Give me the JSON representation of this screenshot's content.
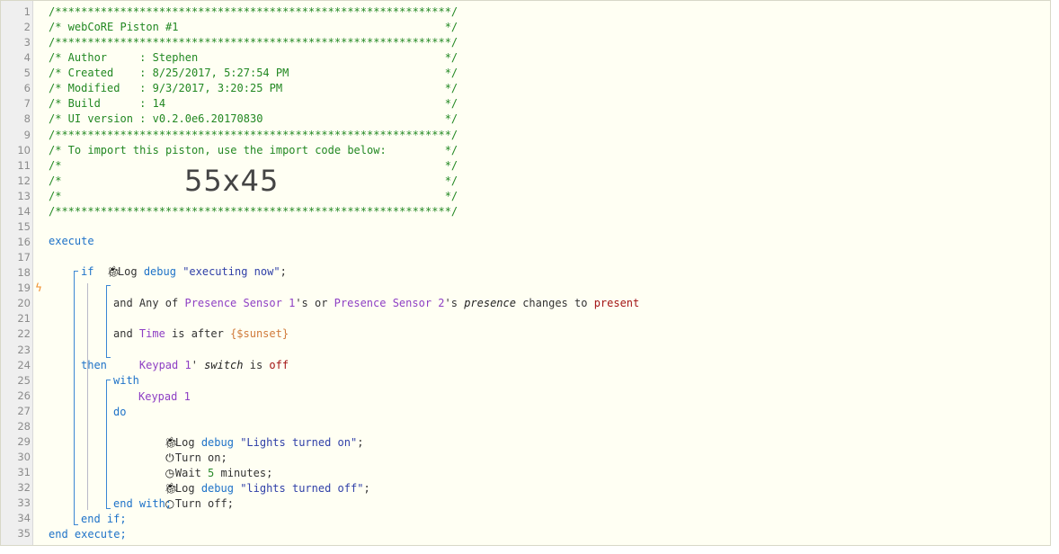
{
  "header_comments": [
    "/*************************************************************/",
    "/* webCoRE Piston #1                                         */",
    "/*************************************************************/",
    "/* Author     : Stephen                                      */",
    "/* Created    : 8/25/2017, 5:27:54 PM                        */",
    "/* Modified   : 9/3/2017, 3:20:25 PM                         */",
    "/* Build      : 14                                           */",
    "/* UI version : v0.2.0e6.20170830                            */",
    "/*************************************************************/",
    "/* To import this piston, use the import code below:         */",
    "/*                                                           */",
    "/*                                                           */",
    "/*                                                           */",
    "/*************************************************************/"
  ],
  "import_code": "55x45",
  "line_numbers": [
    "1",
    "2",
    "3",
    "4",
    "5",
    "6",
    "7",
    "8",
    "9",
    "10",
    "11",
    "12",
    "13",
    "14",
    "15",
    "16",
    "17",
    "18",
    "19",
    "20",
    "21",
    "22",
    "23",
    "24",
    "25",
    "26",
    "27",
    "28",
    "29",
    "30",
    "31",
    "32",
    "33",
    "34",
    "35"
  ],
  "code": {
    "execute": "execute",
    "log1": {
      "word": "Log",
      "level": "debug",
      "msg": "\"executing now\"",
      "end": ";"
    },
    "if": "if",
    "cond1": {
      "any_of": "Any of ",
      "dev1": "Presence Sensor 1",
      "poss1": "'s or ",
      "dev2": "Presence Sensor 2",
      "poss2": "'s ",
      "attr": "presence",
      "op": " changes to ",
      "value": "present"
    },
    "and1": "and",
    "cond2": {
      "subject": "Time",
      "op": " is after ",
      "value": "{$sunset}"
    },
    "and2": "and",
    "cond3": {
      "dev": "Keypad 1",
      "poss": "' ",
      "attr": "switch",
      "op": " is ",
      "value": "off"
    },
    "then": "then",
    "with": "with",
    "with_device": "Keypad 1",
    "do": "do",
    "log2": {
      "word": "Log",
      "level": "debug",
      "msg": "\"Lights turned on\"",
      "end": ";"
    },
    "turn_on": "Turn on;",
    "wait": {
      "word": "Wait ",
      "num": "5",
      "unit": " minutes;"
    },
    "log3": {
      "word": "Log",
      "level": "debug",
      "msg": "\"lights turned off\"",
      "end": ";"
    },
    "turn_off": "Turn off;",
    "end_with": "end with;",
    "end_if": "end if;",
    "end_execute": "end execute;"
  },
  "icons": {
    "bug": "bug-icon",
    "power": "power-icon",
    "clock": "clock-icon",
    "power_off": "power-off-icon",
    "trigger": "lightning-icon"
  },
  "colors": {
    "comment": "#228822",
    "keyword": "#1e72c8",
    "device": "#8e3fc4",
    "string": "#3040a8",
    "value": "#a31515",
    "variable": "#d07a3a",
    "background": "#fffff3"
  }
}
